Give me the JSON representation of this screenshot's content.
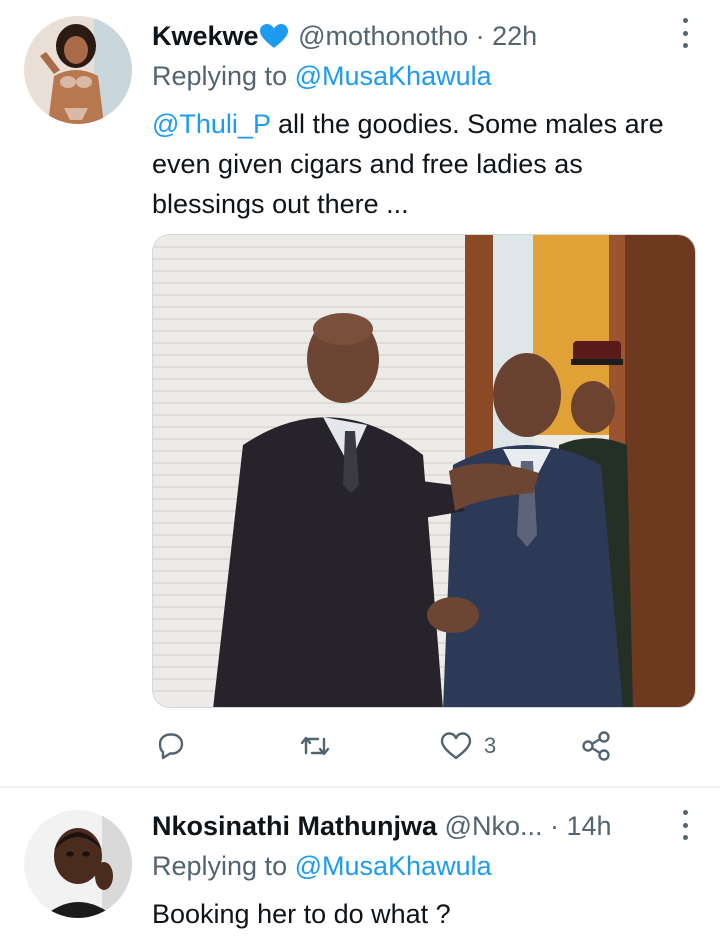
{
  "tweets": [
    {
      "name": "Kwekwe",
      "handle": "@mothonotho",
      "separator": "·",
      "time": "22h",
      "replying_prefix": "Replying to",
      "replying_to": "@MusaKhawula",
      "mention": "@Thuli_P",
      "text": " all the goodies. Some males are even given cigars and free ladies as blessings out there ...",
      "has_media": true,
      "actions": {
        "reply_count": "",
        "retweet_count": "",
        "like_count": "3"
      }
    },
    {
      "name": "Nkosinathi Mathunjwa",
      "handle": "@Nko...",
      "separator": "·",
      "time": "14h",
      "replying_prefix": "Replying to",
      "replying_to": "@MusaKhawula",
      "text": "Booking her to do what ?"
    }
  ],
  "colors": {
    "text_primary": "#0f1419",
    "text_secondary": "#536471",
    "link": "#1d9bf0",
    "divider": "#eff3f4",
    "blue_heart": "#1d9bf0"
  },
  "icons": [
    "blue-heart-icon",
    "more-icon",
    "reply-icon",
    "retweet-icon",
    "like-icon",
    "share-icon"
  ]
}
